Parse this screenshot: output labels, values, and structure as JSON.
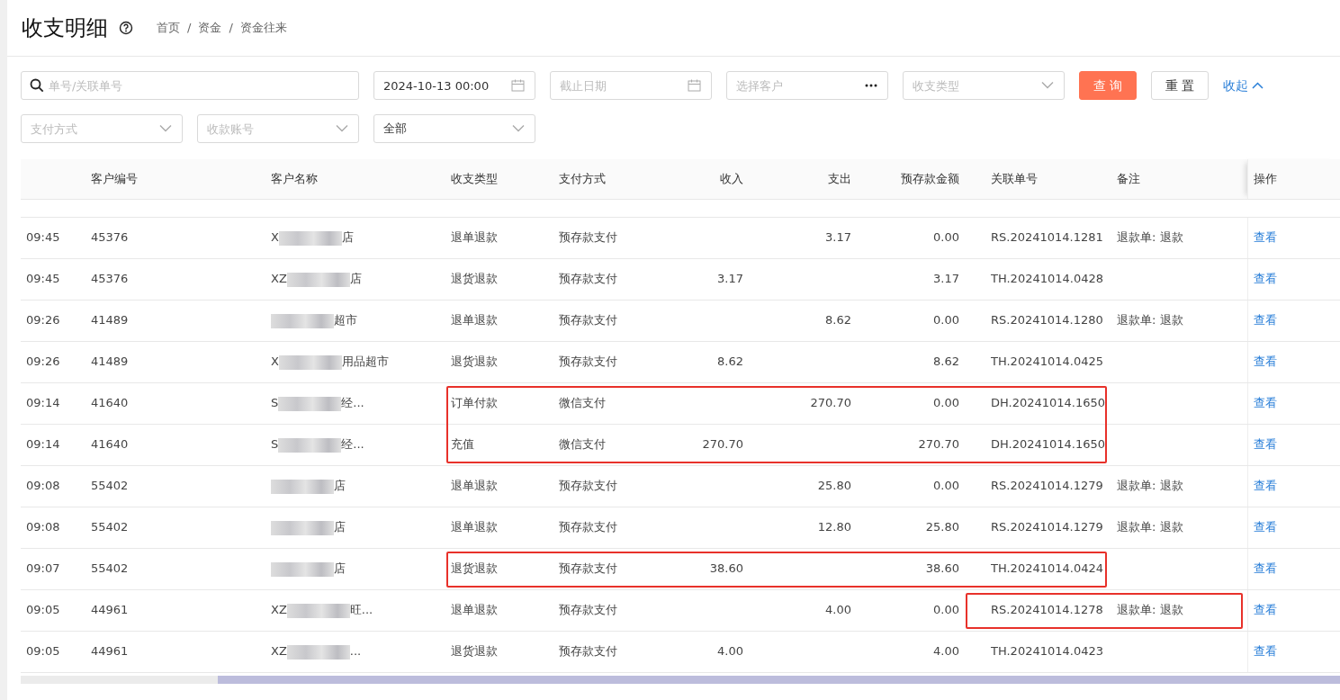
{
  "page": {
    "title": "收支明细",
    "breadcrumb": [
      "首页",
      "/",
      "资金",
      "/",
      "资金往来"
    ]
  },
  "filter_rows": [
    {
      "fields": [
        {
          "kind": "search",
          "placeholder": "单号/关联单号"
        },
        {
          "kind": "date",
          "value": "2024-10-13 00:00"
        },
        {
          "kind": "date",
          "placeholder": "截止日期"
        },
        {
          "kind": "picker",
          "placeholder": "选择客户"
        },
        {
          "kind": "select",
          "placeholder": "收支类型"
        }
      ],
      "buttons": [
        {
          "kind": "primary",
          "label": "查 询"
        },
        {
          "kind": "default",
          "label": "重 置"
        }
      ],
      "toggle": {
        "label": "收起",
        "expanded": true
      }
    },
    {
      "fields": [
        {
          "kind": "select",
          "placeholder": "支付方式"
        },
        {
          "kind": "select",
          "placeholder": "收款账号"
        },
        {
          "kind": "select",
          "value": "全部"
        }
      ]
    }
  ],
  "table": {
    "columns": [
      "客户编号",
      "客户名称",
      "收支类型",
      "支付方式",
      "收入",
      "支出",
      "预存款金额",
      "关联单号",
      "备注",
      "操作"
    ],
    "rows": [
      {
        "time": "09:45",
        "customer_no": "45376",
        "name_prefix": "X",
        "name_suffix": "店",
        "type": "退单退款",
        "payment": "预存款支付",
        "income": "",
        "expense": "3.17",
        "balance": "0.00",
        "ref": "RS.20241014.1281",
        "note": "退款单: 退款",
        "action": "查看"
      },
      {
        "time": "09:45",
        "customer_no": "45376",
        "name_prefix": "XZ",
        "name_suffix": "店",
        "type": "退货退款",
        "payment": "预存款支付",
        "income": "3.17",
        "expense": "",
        "balance": "3.17",
        "ref": "TH.20241014.0428",
        "note": "",
        "action": "查看"
      },
      {
        "time": "09:26",
        "customer_no": "41489",
        "name_prefix": "",
        "name_suffix": "超市",
        "type": "退单退款",
        "payment": "预存款支付",
        "income": "",
        "expense": "8.62",
        "balance": "0.00",
        "ref": "RS.20241014.1280",
        "note": "退款单: 退款",
        "action": "查看"
      },
      {
        "time": "09:26",
        "customer_no": "41489",
        "name_prefix": "X",
        "name_suffix": "用品超市",
        "type": "退货退款",
        "payment": "预存款支付",
        "income": "8.62",
        "expense": "",
        "balance": "8.62",
        "ref": "TH.20241014.0425",
        "note": "",
        "action": "查看"
      },
      {
        "time": "09:14",
        "customer_no": "41640",
        "name_prefix": "S",
        "name_suffix": "经...",
        "type": "订单付款",
        "payment": "微信支付",
        "income": "",
        "expense": "270.70",
        "balance": "0.00",
        "ref": "DH.20241014.1650",
        "note": "",
        "action": "查看",
        "frame": {
          "kind": "transaction"
        }
      },
      {
        "time": "09:14",
        "customer_no": "41640",
        "name_prefix": "S",
        "name_suffix": "经...",
        "type": "充值",
        "payment": "微信支付",
        "income": "270.70",
        "expense": "",
        "balance": "270.70",
        "ref": "DH.20241014.1650",
        "note": "",
        "action": "查看",
        "frame": {
          "kind": "transaction"
        }
      },
      {
        "time": "09:08",
        "customer_no": "55402",
        "name_prefix": "",
        "name_suffix": "店",
        "type": "退单退款",
        "payment": "预存款支付",
        "income": "",
        "expense": "25.80",
        "balance": "0.00",
        "ref": "RS.20241014.1279",
        "note": "退款单: 退款",
        "action": "查看"
      },
      {
        "time": "09:08",
        "customer_no": "55402",
        "name_prefix": "",
        "name_suffix": "店",
        "type": "退单退款",
        "payment": "预存款支付",
        "income": "",
        "expense": "12.80",
        "balance": "25.80",
        "ref": "RS.20241014.1279",
        "note": "退款单: 退款",
        "action": "查看"
      },
      {
        "time": "09:07",
        "customer_no": "55402",
        "name_prefix": "",
        "name_suffix": "店",
        "type": "退货退款",
        "payment": "预存款支付",
        "income": "38.60",
        "expense": "",
        "balance": "38.60",
        "ref": "TH.20241014.0424",
        "note": "",
        "action": "查看",
        "frame": {
          "kind": "transaction"
        }
      },
      {
        "time": "09:05",
        "customer_no": "44961",
        "name_prefix": "XZ",
        "name_suffix": "旺...",
        "type": "退单退款",
        "payment": "预存款支付",
        "income": "",
        "expense": "4.00",
        "balance": "0.00",
        "ref": "RS.20241014.1278",
        "note": "退款单: 退款",
        "action": "查看",
        "frame": {
          "kind": "reference"
        }
      },
      {
        "time": "09:05",
        "customer_no": "44961",
        "name_prefix": "XZ",
        "name_suffix": "...",
        "type": "退货退款",
        "payment": "预存款支付",
        "income": "4.00",
        "expense": "",
        "balance": "4.00",
        "ref": "TH.20241014.0423",
        "note": "",
        "action": "查看"
      }
    ]
  }
}
